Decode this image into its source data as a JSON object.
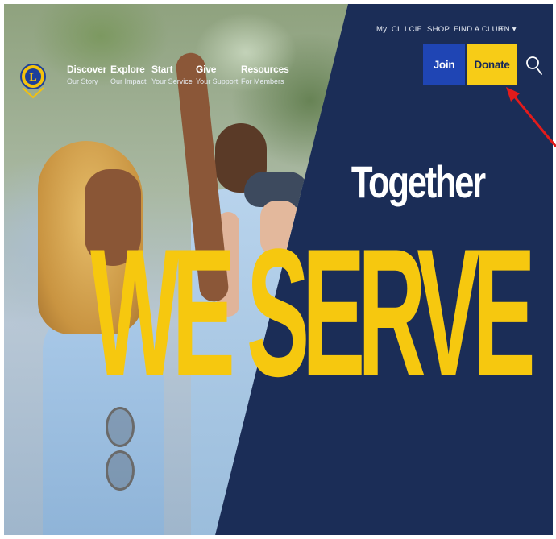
{
  "nav": {
    "items": [
      {
        "label": "Discover",
        "sub": "Our Story"
      },
      {
        "label": "Explore",
        "sub": "Our Impact"
      },
      {
        "label": "Start",
        "sub": "Your Service"
      },
      {
        "label": "Give",
        "sub": "Your Support"
      },
      {
        "label": "Resources",
        "sub": "For Members"
      }
    ]
  },
  "utility": {
    "links": [
      "MyLCI",
      "LCIF",
      "SHOP",
      "FIND A CLUB"
    ],
    "language": "EN ▾"
  },
  "buttons": {
    "join": "Join",
    "donate": "Donate"
  },
  "icons": {
    "logo": "lions-logo-icon",
    "search": "search-icon",
    "annotation": "red-arrow-icon"
  },
  "hero": {
    "line1": "Together",
    "line2": "WE SERVE"
  },
  "colors": {
    "navy": "#1b2d57",
    "join_blue": "#1f45b4",
    "donate_yellow": "#f7cc17",
    "serve_yellow": "#f6c80f",
    "arrow_red": "#e31b1b"
  }
}
